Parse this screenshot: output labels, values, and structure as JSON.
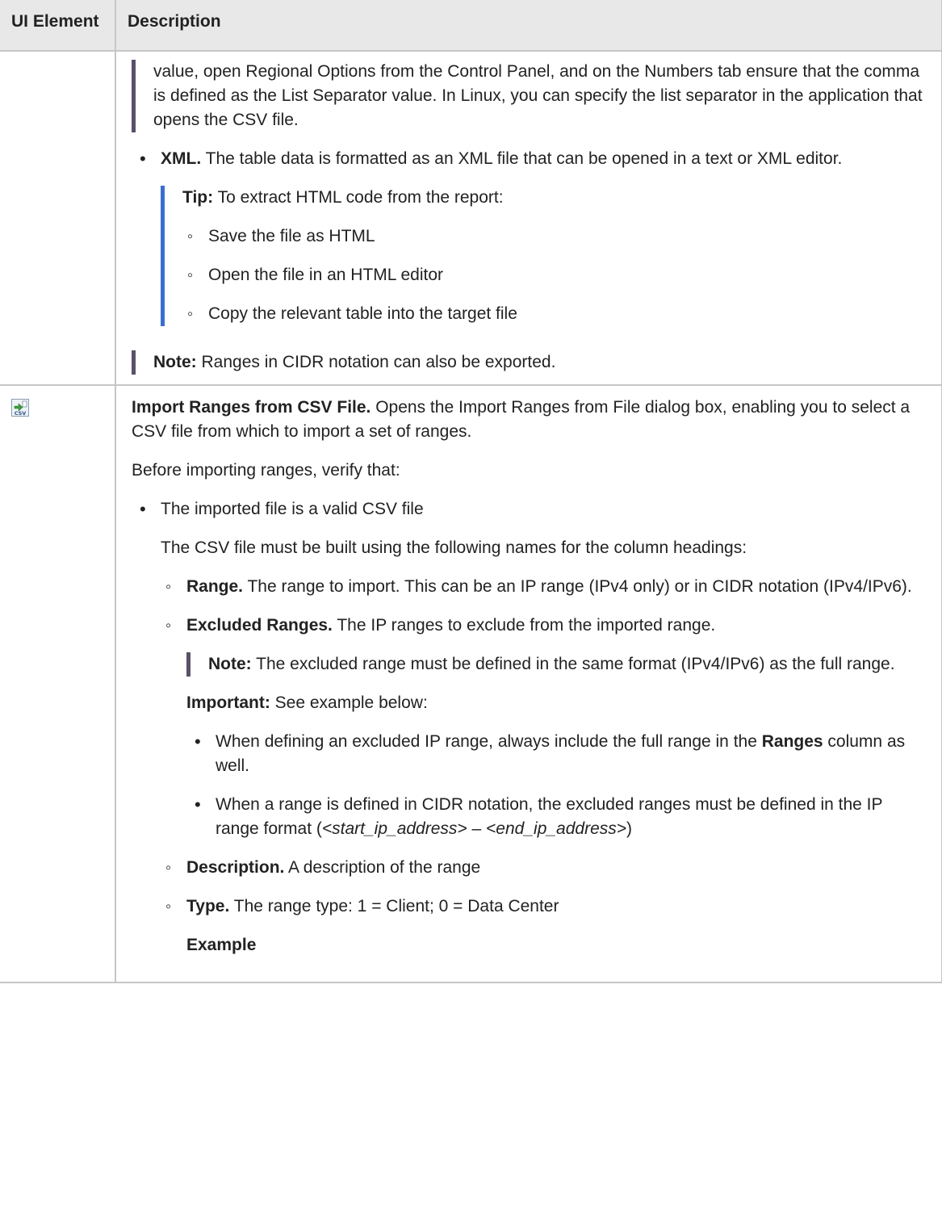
{
  "table": {
    "header": {
      "col1": "UI Element",
      "col2": "Description"
    }
  },
  "row1": {
    "cont_block": "value, open Regional Options from the Control Panel, and on the Numbers tab ensure that the comma is defined as the List Separator value. In Linux, you can specify the list separator in the application that opens the CSV file.",
    "xml_lead": "XML.",
    "xml_text": " The table data is formatted as an XML file that can be opened in a text or XML editor.",
    "tip_lead": "Tip:",
    "tip_text": "  To extract HTML code from the report:",
    "tip_items": [
      "Save the file as HTML",
      "Open the file in an HTML editor",
      "Copy the relevant table into the target file"
    ],
    "note_lead": "Note:",
    "note_text": "  Ranges in CIDR notation can also be exported."
  },
  "row2": {
    "icon": "import-csv-icon",
    "title_lead": "Import Ranges from CSV File.",
    "title_text": " Opens the Import Ranges from File dialog box, enabling you to select a CSV file from which to import a set of ranges.",
    "verify": "Before importing ranges, verify that:",
    "bullet1": "The imported file is a valid CSV file",
    "bullet1_sub": "The CSV file must be built using the following names for the column headings:",
    "range_lead": "Range.",
    "range_text": " The range to import. This can be an IP range (IPv4 only) or in CIDR notation (IPv4/IPv6).",
    "excl_lead": "Excluded Ranges.",
    "excl_text": " The IP ranges to exclude from the imported range.",
    "excl_note_lead": "Note:",
    "excl_note_text": "  The excluded range must be defined in the same format (IPv4/IPv6) as the full range.",
    "important_lead": "Important:",
    "important_text": " See example below:",
    "imp1_pre": "When defining an excluded IP range, always include the full range in the ",
    "imp1_bold": "Ranges",
    "imp1_post": " column as well.",
    "imp2_pre": "When a range is defined in CIDR notation, the excluded ranges must be defined in the IP range format (",
    "imp2_i1": "<start_ip_address>",
    "imp2_mid": " – ",
    "imp2_i2": "<end_ip_address>",
    "imp2_post": ")",
    "desc_lead": "Description.",
    "desc_text": " A description of the range",
    "type_lead": "Type.",
    "type_text": " The range type: 1 = Client; 0 = Data Center",
    "example": "Example"
  },
  "colors": {
    "header_bg": "#e8e8e8",
    "border": "#c6c6c6",
    "note_bar": "#5a5068",
    "tip_bar": "#3b6fcf"
  }
}
